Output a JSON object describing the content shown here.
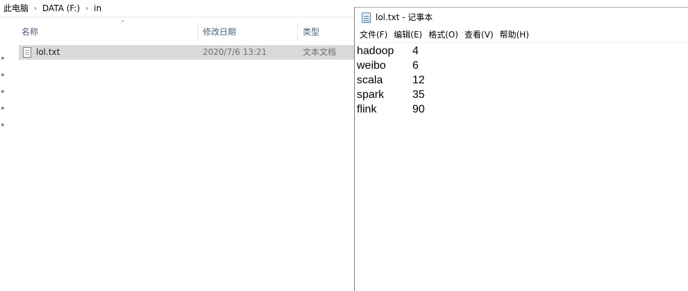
{
  "explorer": {
    "breadcrumb": [
      "此电脑",
      "DATA (F:)",
      "in"
    ],
    "columns": {
      "name": "名称",
      "date": "修改日期",
      "type": "类型"
    },
    "files": [
      {
        "name": "lol.txt",
        "date": "2020/7/6 13:21",
        "type": "文本文档",
        "icon": "text-file-icon"
      }
    ]
  },
  "notepad": {
    "title": "lol.txt - 记事本",
    "menu": [
      "文件(F)",
      "编辑(E)",
      "格式(O)",
      "查看(V)",
      "帮助(H)"
    ],
    "lines": [
      {
        "word": "hadoop",
        "count": "4"
      },
      {
        "word": "weibo",
        "count": "6"
      },
      {
        "word": "scala",
        "count": "12"
      },
      {
        "word": "spark",
        "count": "35"
      },
      {
        "word": "flink",
        "count": "90"
      }
    ]
  }
}
